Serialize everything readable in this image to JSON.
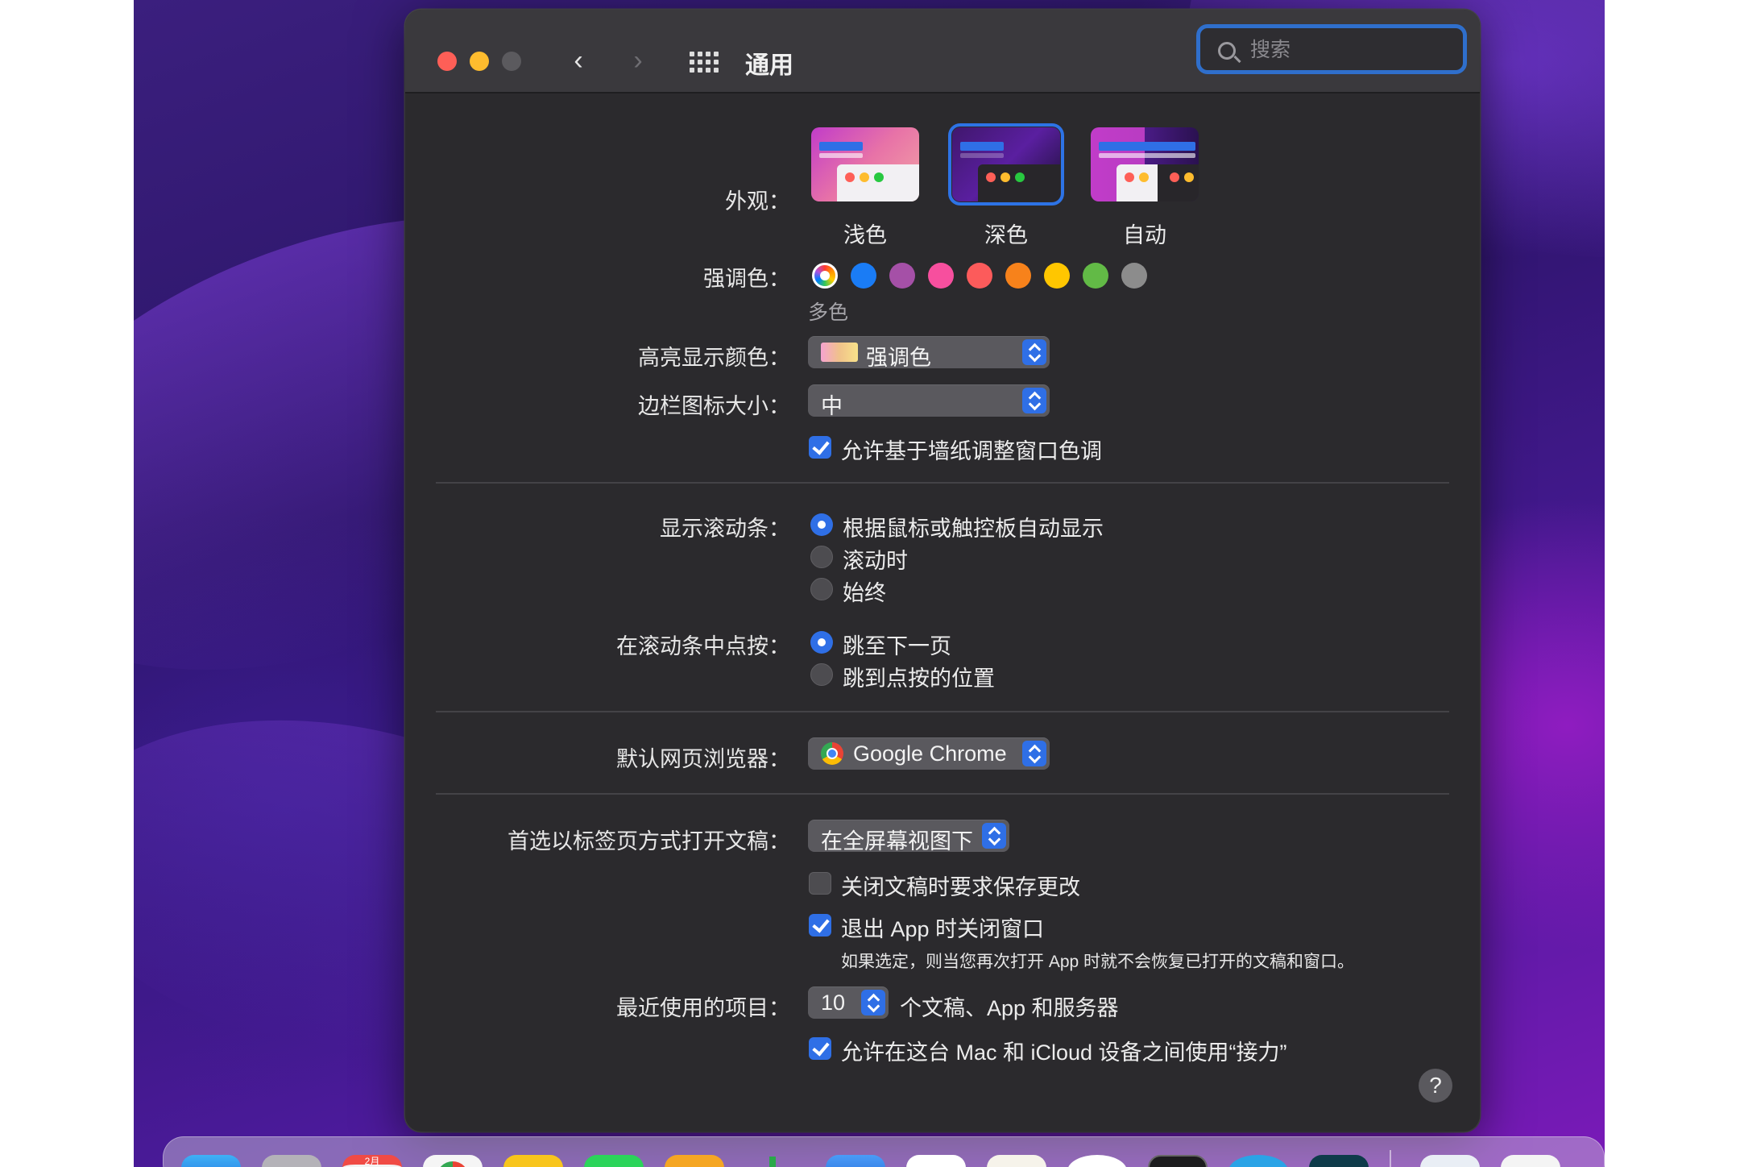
{
  "window": {
    "title": "通用",
    "search_placeholder": "搜索"
  },
  "appearance": {
    "label": "外观：",
    "options": [
      "浅色",
      "深色",
      "自动"
    ],
    "selected": "深色"
  },
  "accent": {
    "label": "强调色：",
    "selected_name": "多色",
    "colors": [
      "multicolor",
      "#1a7cf5",
      "#a550a7",
      "#f74f9e",
      "#fc5b5b",
      "#f7821b",
      "#ffc600",
      "#62ba46",
      "#8c8c8c"
    ]
  },
  "highlight": {
    "label": "高亮显示颜色：",
    "value": "强调色"
  },
  "sidebar_icon": {
    "label": "边栏图标大小：",
    "value": "中"
  },
  "wallpaper_tint": {
    "label": "允许基于墙纸调整窗口色调",
    "checked": true
  },
  "scrollbars": {
    "label": "显示滚动条：",
    "options": [
      "根据鼠标或触控板自动显示",
      "滚动时",
      "始终"
    ],
    "selected": "根据鼠标或触控板自动显示"
  },
  "scroll_click": {
    "label": "在滚动条中点按：",
    "options": [
      "跳至下一页",
      "跳到点按的位置"
    ],
    "selected": "跳至下一页"
  },
  "browser": {
    "label": "默认网页浏览器：",
    "value": "Google Chrome"
  },
  "tabs": {
    "label": "首选以标签页方式打开文稿：",
    "value": "在全屏幕视图下"
  },
  "ask_save": {
    "label": "关闭文稿时要求保存更改",
    "checked": false
  },
  "close_windows": {
    "label": "退出 App 时关闭窗口",
    "checked": true,
    "note": "如果选定，则当您再次打开 App 时就不会恢复已打开的文稿和窗口。"
  },
  "recent": {
    "label": "最近使用的项目：",
    "value": "10",
    "suffix": "个文稿、App 和服务器"
  },
  "handoff": {
    "label": "允许在这台 Mac 和 iCloud 设备之间使用“接力”",
    "checked": true
  },
  "help": {
    "label": "?"
  },
  "dock": {
    "calendar_month": "2月"
  }
}
